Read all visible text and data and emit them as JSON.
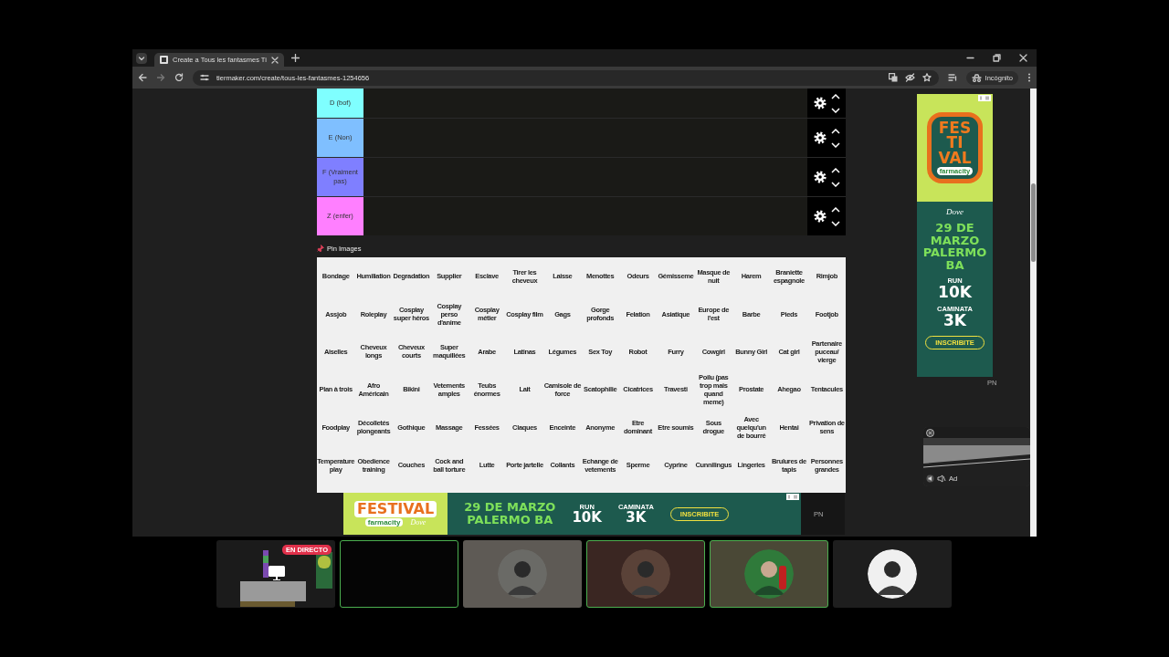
{
  "browser": {
    "tab": {
      "title": "Create a Tous les fantasmes Ti",
      "selected": true
    },
    "address": "tiermaker.com/create/tous-les-fantasmes-1254656",
    "profile": "Incógnito"
  },
  "tiers": [
    {
      "label": "D (bof)",
      "color": "#7fffff"
    },
    {
      "label": "E (Non)",
      "color": "#7fbfff"
    },
    {
      "label": "F (Vraiment pas)",
      "color": "#7f7fff"
    },
    {
      "label": "Z (enfer)",
      "color": "#ff7fff"
    }
  ],
  "pin_label": "Pin Images",
  "items": [
    "Bondage",
    "Humiliation",
    "Degradation",
    "Supplier",
    "Esclave",
    "Tirer les cheveux",
    "Laisse",
    "Menottes",
    "Odeurs",
    "Gémisseme",
    "Masque de nuit",
    "Harem",
    "Braniette espagnole",
    "Rimjob",
    "Assjob",
    "Roleplay",
    "Cosplay super héros",
    "Cosplay perso d'anime",
    "Cosplay métier",
    "Cosplay film",
    "Gags",
    "Gorge profonds",
    "Felation",
    "Asiatique",
    "Europe de l'est",
    "Barbe",
    "Pieds",
    "Footjob",
    "Aiselles",
    "Cheveux longs",
    "Cheveux courts",
    "Super maquillées",
    "Arabe",
    "Latinas",
    "Légumes",
    "Sex Toy",
    "Robot",
    "Furry",
    "Cowgirl",
    "Bunny Girl",
    "Cat girl",
    "Partenaire puceau/ vierge",
    "Plan à trois",
    "Afro Américain",
    "Bikini",
    "Vetements amples",
    "Teubs énormes",
    "Lait",
    "Camisole de force",
    "Scatophilie",
    "Cicatrices",
    "Travesti",
    "Poilu (pas trop mais quand meme)",
    "Prostate",
    "Ahegao",
    "Tentacules",
    "Foodplay",
    "Décolletés plongeants",
    "Gothique",
    "Massage",
    "Fessées",
    "Claques",
    "Enceinte",
    "Anonyme",
    "Etre dominant",
    "Etre soumis",
    "Sous drogue",
    "Avec quelqu'un de bourré",
    "Hentai",
    "Privation de sens",
    "Temperature play",
    "Obedience training",
    "Couches",
    "Cock and ball torture",
    "Lutte",
    "Porte jartelle",
    "Collants",
    "Echange de vetements",
    "Sperme",
    "Cyprine",
    "Cunnilingus",
    "Lingeries",
    "Brulures de tapis",
    "Personnes grandes"
  ],
  "side_ad": {
    "title_lines": [
      "FES",
      "TI",
      "VAL"
    ],
    "brand": "farmacity",
    "sponsor": "Dove",
    "date_lines": [
      "29 DE",
      "MARZO",
      "PALERMO",
      "BA"
    ],
    "run": "RUN",
    "run_distance": "10K",
    "walk": "CAMINATA",
    "walk_distance": "3K",
    "cta": "INSCRIBITE",
    "mark": "PN"
  },
  "video_ad": {
    "label": "Ad"
  },
  "bottom_ad": {
    "title": "FESTIVAL",
    "brand": "farmacity",
    "sponsor": "Dove",
    "date_lines": [
      "29 DE MARZO",
      "PALERMO BA"
    ],
    "run": "RUN",
    "run_distance": "10K",
    "walk": "CAMINATA",
    "walk_distance": "3K",
    "cta": "INSCRIBITE",
    "mark": "PN"
  },
  "participants": [
    {
      "kind": "screen",
      "speaking": false,
      "badge": "EN DIRECTO"
    },
    {
      "kind": "blank",
      "speaking": true
    },
    {
      "kind": "avatar",
      "speaking": false
    },
    {
      "kind": "avatar",
      "speaking": true
    },
    {
      "kind": "avatar",
      "speaking": true
    },
    {
      "kind": "avatar",
      "speaking": false
    }
  ]
}
